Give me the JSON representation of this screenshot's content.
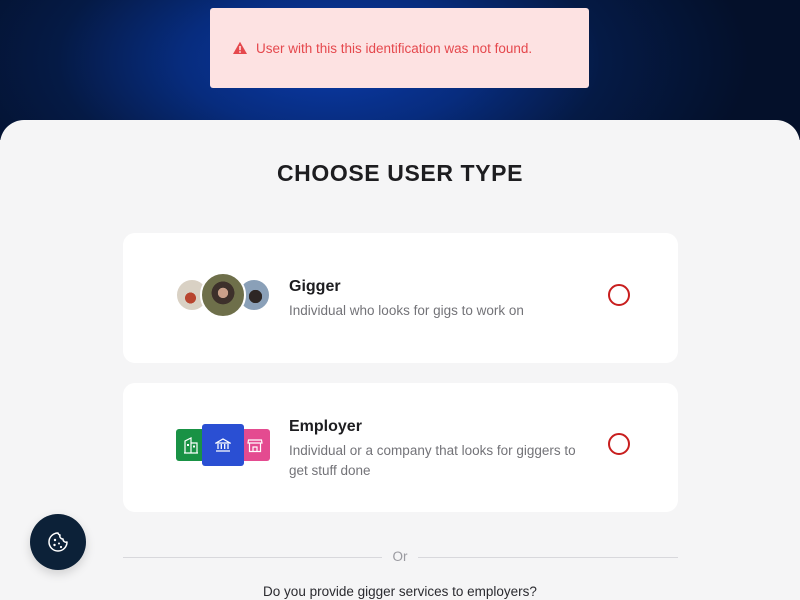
{
  "alert": {
    "message": "User with this this identification was not found.",
    "icon": "warning-icon",
    "color": "#e5484d"
  },
  "page": {
    "title": "CHOOSE USER TYPE"
  },
  "options": [
    {
      "title": "Gigger",
      "description": "Individual who looks for gigs to work on",
      "selected": false
    },
    {
      "title": "Employer",
      "description": "Individual or a company that looks for giggers to get stuff done",
      "selected": false
    }
  ],
  "divider": {
    "label": "Or"
  },
  "footer": {
    "question": "Do you provide gigger services to employers?"
  },
  "cookie_button": {
    "icon": "cookie-icon"
  },
  "colors": {
    "radio_accent": "#c81e1e",
    "hero_dark": "#04102a",
    "hero_blue": "#0b3aa8"
  }
}
